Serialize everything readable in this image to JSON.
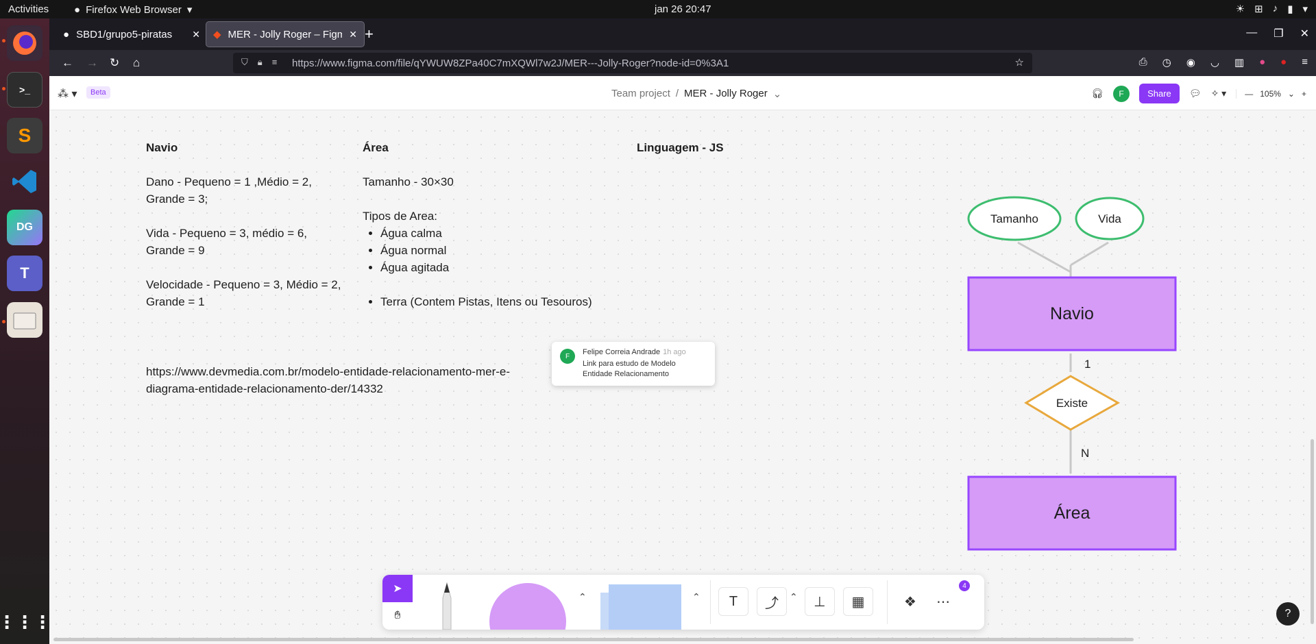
{
  "system": {
    "activities": "Activities",
    "app_menu": "Firefox Web Browser",
    "clock": "jan 26  20:47"
  },
  "browser": {
    "tabs": [
      {
        "label": "SBD1/grupo5-piratas"
      },
      {
        "label": "MER - Jolly Roger – Figma"
      }
    ],
    "url": "https://www.figma.com/file/qYWUW8ZPa40C7mXQWl7w2J/MER---Jolly-Roger?node-id=0%3A1"
  },
  "figma": {
    "beta": "Beta",
    "breadcrumb_project": "Team project",
    "breadcrumb_sep": "/",
    "file_name": "MER - Jolly Roger",
    "avatar_initial": "F",
    "share_label": "Share",
    "zoom": "105%",
    "toolbar_badge": "4",
    "help": "?"
  },
  "canvas": {
    "navio": {
      "title": "Navio",
      "dano": "Dano - Pequeno = 1 ,Médio = 2, Grande = 3;",
      "vida": "Vida - Pequeno = 3, médio = 6, Grande = 9",
      "velocidade": "Velocidade - Pequeno = 3, Médio = 2, Grande = 1"
    },
    "area": {
      "title": "Área",
      "tamanho": "Tamanho - 30×30",
      "tipos": "Tipos de Area:",
      "items": [
        "Água calma",
        "Água normal",
        "Água agitada"
      ],
      "terra": "Terra (Contem Pistas, Itens ou Tesouros)"
    },
    "linguagem": "Linguagem - JS",
    "link": "https://www.devmedia.com.br/modelo-entidade-relacionamento-mer-e-diagrama-entidade-relacionamento-der/14332",
    "comment": {
      "initial": "F",
      "author": "Felipe Correia Andrade",
      "time": "1h ago",
      "text": "Link para estudo de Modelo Entidade Relacionamento"
    },
    "diagram": {
      "attr_tamanho": "Tamanho",
      "attr_vida": "Vida",
      "entity_navio": "Navio",
      "relation": "Existe",
      "card_top": "1",
      "card_bottom": "N",
      "entity_area": "Área",
      "colors": {
        "entity_fill": "#d59bf7",
        "entity_border": "#9747ff",
        "attr_border": "#3dbd6f",
        "relation_border": "#e8a83c"
      }
    }
  }
}
